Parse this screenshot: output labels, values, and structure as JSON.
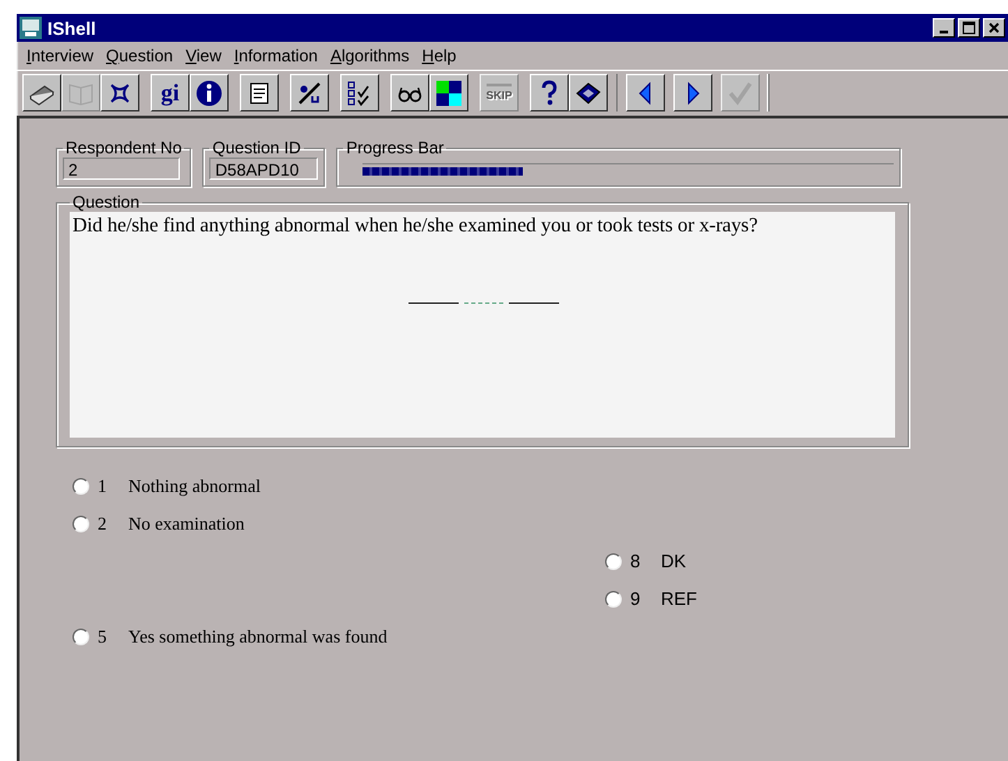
{
  "window": {
    "title": "IShell"
  },
  "menu": [
    {
      "label": "Interview"
    },
    {
      "label": "Question"
    },
    {
      "label": "View"
    },
    {
      "label": "Information"
    },
    {
      "label": "Algorithms"
    },
    {
      "label": "Help"
    }
  ],
  "toolbar": [
    [
      {
        "kind": "book",
        "disabled": false
      },
      {
        "kind": "open-book",
        "disabled": true
      },
      {
        "kind": "knot",
        "disabled": false
      }
    ],
    [
      {
        "kind": "text",
        "label": "gi",
        "disabled": false
      },
      {
        "kind": "info",
        "disabled": false
      }
    ],
    [
      {
        "kind": "notepad",
        "disabled": false
      }
    ],
    [
      {
        "kind": "language",
        "disabled": false
      }
    ],
    [
      {
        "kind": "checklist",
        "disabled": false
      }
    ],
    [
      {
        "kind": "glasses",
        "disabled": false
      },
      {
        "kind": "colors",
        "disabled": false
      }
    ],
    [
      {
        "kind": "skip",
        "label": "SKIP",
        "disabled": true
      }
    ],
    [
      {
        "kind": "help",
        "disabled": false
      },
      {
        "kind": "manual",
        "disabled": false
      }
    ],
    [
      {
        "kind": "previous",
        "disabled": false
      },
      {
        "kind": "next",
        "disabled": false
      },
      {
        "kind": "confirm",
        "disabled": true
      }
    ]
  ],
  "respondent_no": {
    "label": "Respondent No",
    "value": "2"
  },
  "question_id": {
    "label": "Question ID",
    "value": "D58APD10"
  },
  "progress_bar": {
    "label": "Progress Bar",
    "level": 0.3
  },
  "question": {
    "label": "Question",
    "text": "Did he/she find anything abnormal when he/she examined you or took tests or x-rays?"
  },
  "answers": [
    {
      "kind": "coded",
      "code": "1",
      "label": "Nothing abnormal",
      "selected": false
    },
    {
      "kind": "coded",
      "code": "2",
      "label": "No examination",
      "selected": false
    },
    {
      "kind": "missing",
      "code": "8",
      "label": "DK",
      "selected": false
    },
    {
      "kind": "missing",
      "code": "9",
      "label": "REF",
      "selected": false
    },
    {
      "kind": "coded",
      "code": "5",
      "label": "Yes something abnormal was found",
      "selected": false
    }
  ]
}
